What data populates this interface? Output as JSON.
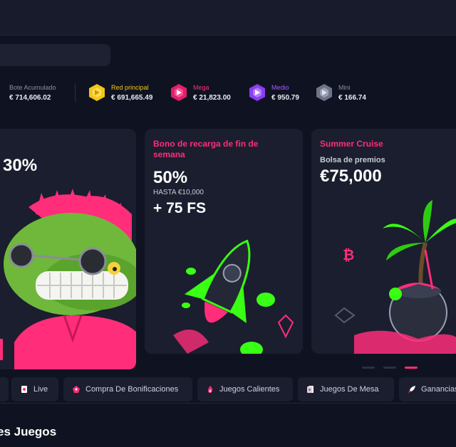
{
  "jackpots": [
    {
      "name": "Bote Acumulado",
      "value": "€ 714,606.02",
      "color": "#8a8fa3",
      "icon": "none"
    },
    {
      "name": "Red principal",
      "value": "€ 691,665.49",
      "color": "#f5c518",
      "icon": "gold-gem-icon"
    },
    {
      "name": "Mega",
      "value": "€ 21,823.00",
      "color": "#ff2d7a",
      "icon": "pink-gem-icon"
    },
    {
      "name": "Medio",
      "value": "€ 950.79",
      "color": "#a259ff",
      "icon": "purple-gem-icon"
    },
    {
      "name": "Mini",
      "value": "€ 166.74",
      "color": "#8a8fa3",
      "icon": "silver-gem-icon"
    }
  ],
  "promos": {
    "card1": {
      "big": "30%"
    },
    "card2": {
      "title": "Bono de recarga de fin de semana",
      "big": "50%",
      "sub": "HASTA €10,000",
      "fs": "+ 75 FS"
    },
    "card3": {
      "title": "Summer Cruise",
      "sub": "Bolsa de premios",
      "big": "€75,000"
    }
  },
  "categories": [
    {
      "label": "Live",
      "icon": "card-icon"
    },
    {
      "label": "Compra De Bonificaciones",
      "icon": "bonus-icon"
    },
    {
      "label": "Juegos Calientes",
      "icon": "flame-icon"
    },
    {
      "label": "Juegos De Mesa",
      "icon": "cards-icon"
    },
    {
      "label": "Ganancias",
      "icon": "rocket-icon"
    }
  ],
  "section": {
    "title": "es Juegos"
  },
  "colors": {
    "accent": "#ff2d7a",
    "neon_green": "#39ff14"
  }
}
